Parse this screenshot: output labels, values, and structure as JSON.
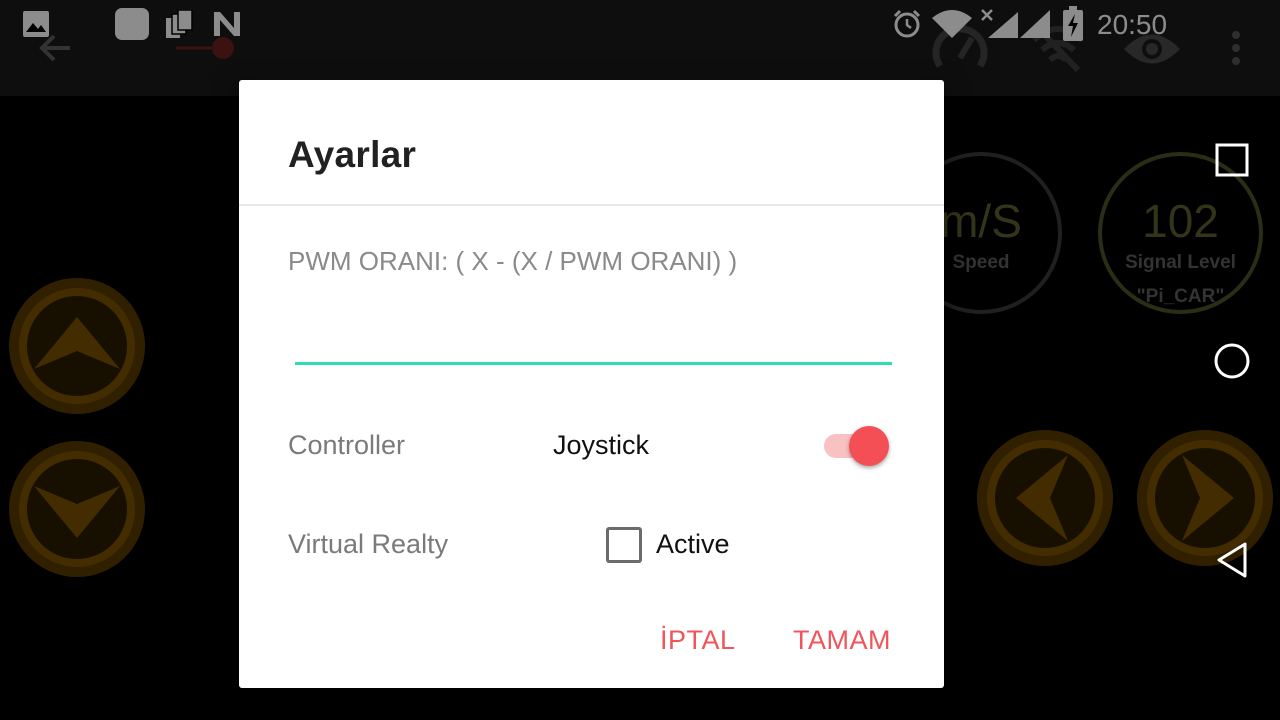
{
  "status_bar": {
    "time": "20:50",
    "icons": [
      "image-icon",
      "app-square-icon",
      "stack-icon",
      "n-logo-icon",
      "alarm-icon",
      "wifi-icon",
      "signal-no-data-icon",
      "battery-charging-icon"
    ]
  },
  "toolbar": {
    "icons": [
      "back-arrow-icon",
      "speedometer-icon",
      "wifi-off-icon",
      "eye-icon",
      "overflow-menu-icon"
    ]
  },
  "gauges": {
    "speed": {
      "value": "m/S",
      "label": "Speed"
    },
    "signal": {
      "value": "102",
      "label": "Signal Level",
      "network": "\"Pi_CAR\""
    }
  },
  "controls": {
    "buttons": [
      "up",
      "down",
      "left",
      "right"
    ],
    "color": "#8a5a00"
  },
  "dialog": {
    "title": "Ayarlar",
    "pwm_label": "PWM ORANI: ( X - (X / PWM ORANI) )",
    "pwm_value": "",
    "controller_label": "Controller",
    "controller_value": "Joystick",
    "controller_switch_on": true,
    "vr_label": "Virtual Realty",
    "vr_checkbox_label": "Active",
    "vr_checked": false,
    "cancel_label": "İPTAL",
    "ok_label": "TAMAM"
  },
  "colors": {
    "accent": "#f34f55",
    "input_underline": "#2ddcb3",
    "gauge_border": "#5d5f2f"
  }
}
